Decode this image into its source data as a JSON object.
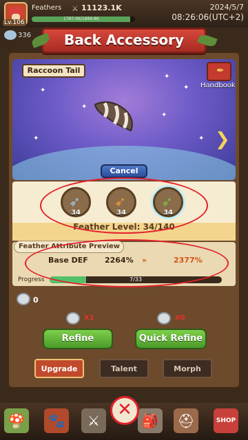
{
  "player": {
    "name": "Feathers",
    "level": "Lv.106",
    "power": "11123.1K",
    "xp_text": "1787.0K/1889.8K",
    "xp_progress": 0.95,
    "gems": "336"
  },
  "clock": {
    "date": "2024/5/7",
    "time": "08:26:06(UTC+2)"
  },
  "title": "Back Accessory",
  "item": {
    "name": "Raccoon Tail"
  },
  "handbook_label": "Handbook",
  "cancel_label": "Cancel",
  "feathers": [
    {
      "icon": "blue-feather-icon",
      "count": "34"
    },
    {
      "icon": "orange-feather-icon",
      "count": "34"
    },
    {
      "icon": "green-feather-icon",
      "count": "34",
      "selected": true
    }
  ],
  "feather_level": "Feather Level: 34/140",
  "attribute_preview": {
    "header": "Feather Attribute Preview",
    "stat": "Base DEF",
    "current": "2264%",
    "next": "2377%"
  },
  "progress": {
    "label": "Progress",
    "text": "7/33",
    "value": 0.21
  },
  "dust_count": "0",
  "refine": {
    "cost": "X1",
    "label": "Refine"
  },
  "quick_refine": {
    "cost": "X0",
    "label": "Quick Refine"
  },
  "tabs": [
    {
      "label": "Upgrade",
      "active": true
    },
    {
      "label": "Talent",
      "active": false
    },
    {
      "label": "Morph",
      "active": false
    }
  ],
  "shop_label": "SHOP",
  "colors": {
    "accent_red": "#e3202a",
    "banner": "#c43a2e",
    "button_green": "#5fb23a"
  }
}
